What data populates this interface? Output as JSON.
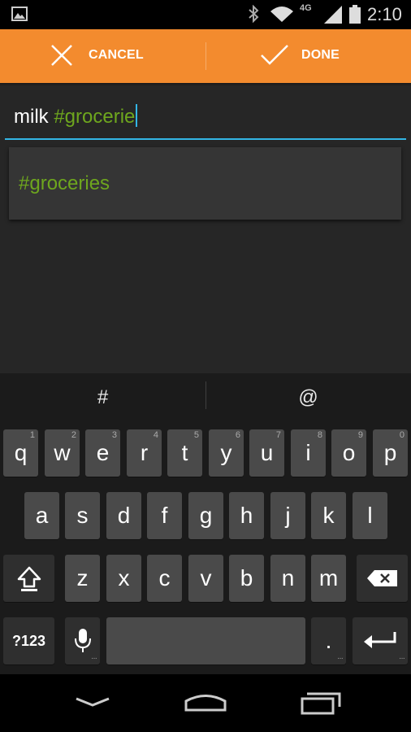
{
  "status_bar": {
    "network": "4G",
    "time": "2:10",
    "icons": [
      "picture-icon",
      "bluetooth-icon",
      "wifi-icon",
      "signal-icon",
      "battery-icon"
    ]
  },
  "action_bar": {
    "cancel_label": "CANCEL",
    "done_label": "DONE",
    "color": "#f38b2e"
  },
  "input": {
    "plain_text": "milk ",
    "tag_text": "#grocerie"
  },
  "suggestion": {
    "text": "#groceries"
  },
  "keyboard": {
    "suggestions": [
      "#",
      "@"
    ],
    "row1": [
      {
        "key": "q",
        "hint": "1"
      },
      {
        "key": "w",
        "hint": "2"
      },
      {
        "key": "e",
        "hint": "3"
      },
      {
        "key": "r",
        "hint": "4"
      },
      {
        "key": "t",
        "hint": "5"
      },
      {
        "key": "y",
        "hint": "6"
      },
      {
        "key": "u",
        "hint": "7"
      },
      {
        "key": "i",
        "hint": "8"
      },
      {
        "key": "o",
        "hint": "9"
      },
      {
        "key": "p",
        "hint": "0"
      }
    ],
    "row2": [
      "a",
      "s",
      "d",
      "f",
      "g",
      "h",
      "j",
      "k",
      "l"
    ],
    "row3": [
      "z",
      "x",
      "c",
      "v",
      "b",
      "n",
      "m"
    ],
    "symbols_label": "?123",
    "period_label": ".",
    "colors": {
      "key": "#4a4a4a",
      "function_key": "#2f2f2f",
      "tag_green": "#6ea61e",
      "accent_blue": "#33b5e5"
    }
  },
  "nav_bar": {
    "icons": [
      "back-icon",
      "home-icon",
      "recents-icon"
    ]
  }
}
